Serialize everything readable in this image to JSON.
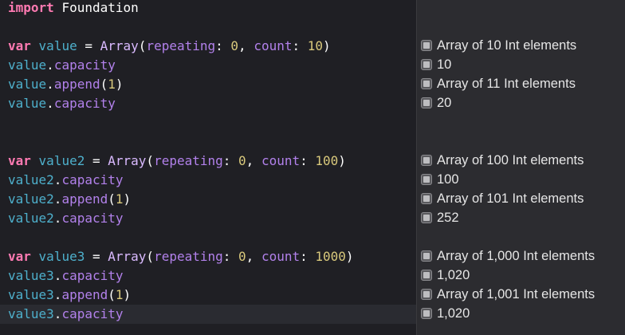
{
  "editor": {
    "lines": [
      {
        "id": "import",
        "tokens": [
          {
            "t": "import",
            "c": "kw"
          },
          {
            "t": " ",
            "c": "plain"
          },
          {
            "t": "Foundation",
            "c": "plain"
          }
        ]
      },
      {
        "id": "var1",
        "tokens": [
          {
            "t": "var",
            "c": "kw"
          },
          {
            "t": " ",
            "c": "plain"
          },
          {
            "t": "value",
            "c": "id"
          },
          {
            "t": " = ",
            "c": "plain"
          },
          {
            "t": "Array",
            "c": "ty"
          },
          {
            "t": "(",
            "c": "plain"
          },
          {
            "t": "repeating",
            "c": "prop"
          },
          {
            "t": ": ",
            "c": "plain"
          },
          {
            "t": "0",
            "c": "num"
          },
          {
            "t": ", ",
            "c": "plain"
          },
          {
            "t": "count",
            "c": "prop"
          },
          {
            "t": ": ",
            "c": "plain"
          },
          {
            "t": "10",
            "c": "num"
          },
          {
            "t": ")",
            "c": "plain"
          }
        ]
      },
      {
        "id": "cap1a",
        "tokens": [
          {
            "t": "value",
            "c": "id"
          },
          {
            "t": ".",
            "c": "plain"
          },
          {
            "t": "capacity",
            "c": "prop"
          }
        ]
      },
      {
        "id": "append1",
        "tokens": [
          {
            "t": "value",
            "c": "id"
          },
          {
            "t": ".",
            "c": "plain"
          },
          {
            "t": "append",
            "c": "prop"
          },
          {
            "t": "(",
            "c": "plain"
          },
          {
            "t": "1",
            "c": "num"
          },
          {
            "t": ")",
            "c": "plain"
          }
        ]
      },
      {
        "id": "cap1b",
        "tokens": [
          {
            "t": "value",
            "c": "id"
          },
          {
            "t": ".",
            "c": "plain"
          },
          {
            "t": "capacity",
            "c": "prop"
          }
        ]
      },
      {
        "id": "var2",
        "tokens": [
          {
            "t": "var",
            "c": "kw"
          },
          {
            "t": " ",
            "c": "plain"
          },
          {
            "t": "value2",
            "c": "id"
          },
          {
            "t": " = ",
            "c": "plain"
          },
          {
            "t": "Array",
            "c": "ty"
          },
          {
            "t": "(",
            "c": "plain"
          },
          {
            "t": "repeating",
            "c": "prop"
          },
          {
            "t": ": ",
            "c": "plain"
          },
          {
            "t": "0",
            "c": "num"
          },
          {
            "t": ", ",
            "c": "plain"
          },
          {
            "t": "count",
            "c": "prop"
          },
          {
            "t": ": ",
            "c": "plain"
          },
          {
            "t": "100",
            "c": "num"
          },
          {
            "t": ")",
            "c": "plain"
          }
        ]
      },
      {
        "id": "cap2a",
        "tokens": [
          {
            "t": "value2",
            "c": "id"
          },
          {
            "t": ".",
            "c": "plain"
          },
          {
            "t": "capacity",
            "c": "prop"
          }
        ]
      },
      {
        "id": "append2",
        "tokens": [
          {
            "t": "value2",
            "c": "id"
          },
          {
            "t": ".",
            "c": "plain"
          },
          {
            "t": "append",
            "c": "prop"
          },
          {
            "t": "(",
            "c": "plain"
          },
          {
            "t": "1",
            "c": "num"
          },
          {
            "t": ")",
            "c": "plain"
          }
        ]
      },
      {
        "id": "cap2b",
        "tokens": [
          {
            "t": "value2",
            "c": "id"
          },
          {
            "t": ".",
            "c": "plain"
          },
          {
            "t": "capacity",
            "c": "prop"
          }
        ]
      },
      {
        "id": "var3",
        "tokens": [
          {
            "t": "var",
            "c": "kw"
          },
          {
            "t": " ",
            "c": "plain"
          },
          {
            "t": "value3",
            "c": "id"
          },
          {
            "t": " = ",
            "c": "plain"
          },
          {
            "t": "Array",
            "c": "ty"
          },
          {
            "t": "(",
            "c": "plain"
          },
          {
            "t": "repeating",
            "c": "prop"
          },
          {
            "t": ": ",
            "c": "plain"
          },
          {
            "t": "0",
            "c": "num"
          },
          {
            "t": ", ",
            "c": "plain"
          },
          {
            "t": "count",
            "c": "prop"
          },
          {
            "t": ": ",
            "c": "plain"
          },
          {
            "t": "1000",
            "c": "num"
          },
          {
            "t": ")",
            "c": "plain"
          }
        ]
      },
      {
        "id": "cap3a",
        "tokens": [
          {
            "t": "value3",
            "c": "id"
          },
          {
            "t": ".",
            "c": "plain"
          },
          {
            "t": "capacity",
            "c": "prop"
          }
        ]
      },
      {
        "id": "append3",
        "tokens": [
          {
            "t": "value3",
            "c": "id"
          },
          {
            "t": ".",
            "c": "plain"
          },
          {
            "t": "append",
            "c": "prop"
          },
          {
            "t": "(",
            "c": "plain"
          },
          {
            "t": "1",
            "c": "num"
          },
          {
            "t": ")",
            "c": "plain"
          }
        ]
      },
      {
        "id": "cap3b",
        "tokens": [
          {
            "t": "value3",
            "c": "id"
          },
          {
            "t": ".",
            "c": "plain"
          },
          {
            "t": "capacity",
            "c": "prop"
          }
        ]
      }
    ]
  },
  "results": [
    {
      "id": "var1",
      "text": "Array of 10 Int elements"
    },
    {
      "id": "cap1a",
      "text": "10"
    },
    {
      "id": "append1",
      "text": "Array of 11 Int elements"
    },
    {
      "id": "cap1b",
      "text": "20"
    },
    {
      "id": "var2",
      "text": "Array of 100 Int elements"
    },
    {
      "id": "cap2a",
      "text": "100"
    },
    {
      "id": "append2",
      "text": "Array of 101 Int elements"
    },
    {
      "id": "cap2b",
      "text": "252"
    },
    {
      "id": "var3",
      "text": "Array of 1,000 Int elements"
    },
    {
      "id": "cap3a",
      "text": "1,020"
    },
    {
      "id": "append3",
      "text": "Array of 1,001 Int elements"
    },
    {
      "id": "cap3b",
      "text": "1,020"
    }
  ],
  "colors": {
    "keyword": "#ff7ab2",
    "type": "#dabaff",
    "identifier": "#4eb0cc",
    "number": "#d9c97c",
    "property": "#b281eb",
    "plain": "#ffffff",
    "editor_bg": "#1f1f24",
    "results_bg": "#2c2c30"
  },
  "icons": {
    "quick_look": "quick-look-icon"
  }
}
